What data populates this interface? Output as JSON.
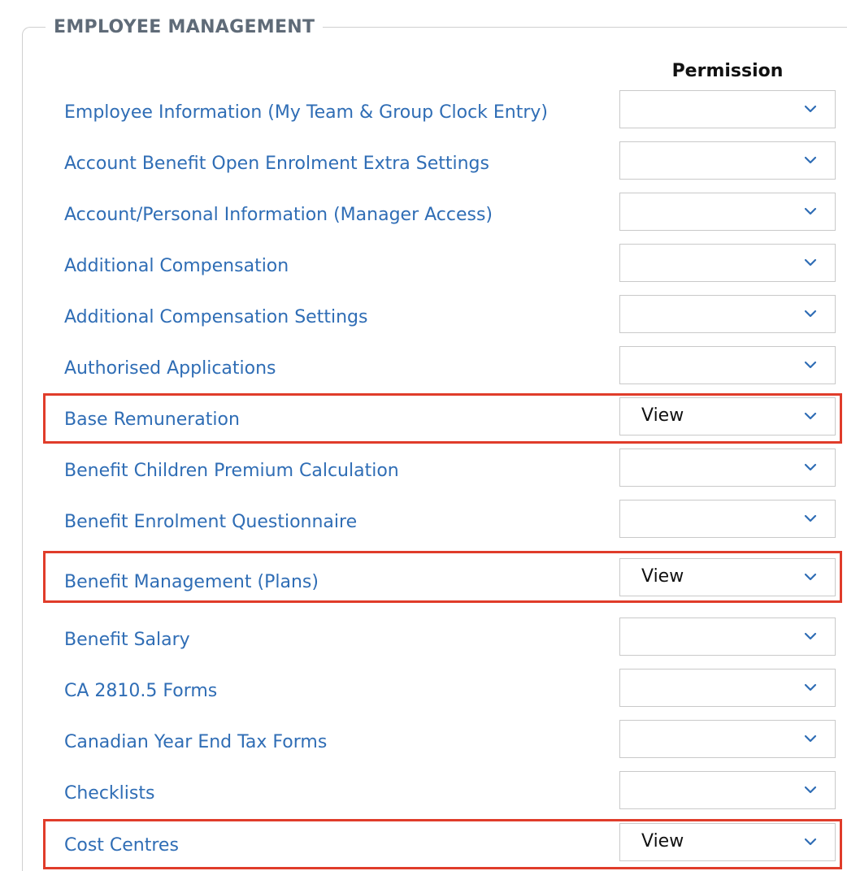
{
  "section": {
    "title": "EMPLOYEE MANAGEMENT",
    "column_header": "Permission"
  },
  "rows": [
    {
      "label": "Employee Information (My Team & Group Clock Entry)",
      "value": ""
    },
    {
      "label": "Account Benefit Open Enrolment Extra Settings",
      "value": ""
    },
    {
      "label": "Account/Personal Information (Manager Access)",
      "value": ""
    },
    {
      "label": "Additional Compensation",
      "value": ""
    },
    {
      "label": "Additional Compensation Settings",
      "value": ""
    },
    {
      "label": "Authorised Applications",
      "value": ""
    },
    {
      "label": "Base Remuneration",
      "value": "View",
      "highlighted": true
    },
    {
      "label": "Benefit Children Premium Calculation",
      "value": ""
    },
    {
      "label": "Benefit Enrolment Questionnaire",
      "value": ""
    },
    {
      "label": "Benefit Management (Plans)",
      "value": "View",
      "highlighted": true
    },
    {
      "label": "Benefit Salary",
      "value": ""
    },
    {
      "label": "CA 2810.5 Forms",
      "value": ""
    },
    {
      "label": "Canadian Year End Tax Forms",
      "value": ""
    },
    {
      "label": "Checklists",
      "value": ""
    },
    {
      "label": "Cost Centres",
      "value": "View",
      "highlighted": true
    }
  ],
  "colors": {
    "link": "#2f6db5",
    "highlight": "#e03c2a",
    "legend": "#5f6b78"
  },
  "icons": {
    "dropdown": "chevron-down-icon"
  }
}
